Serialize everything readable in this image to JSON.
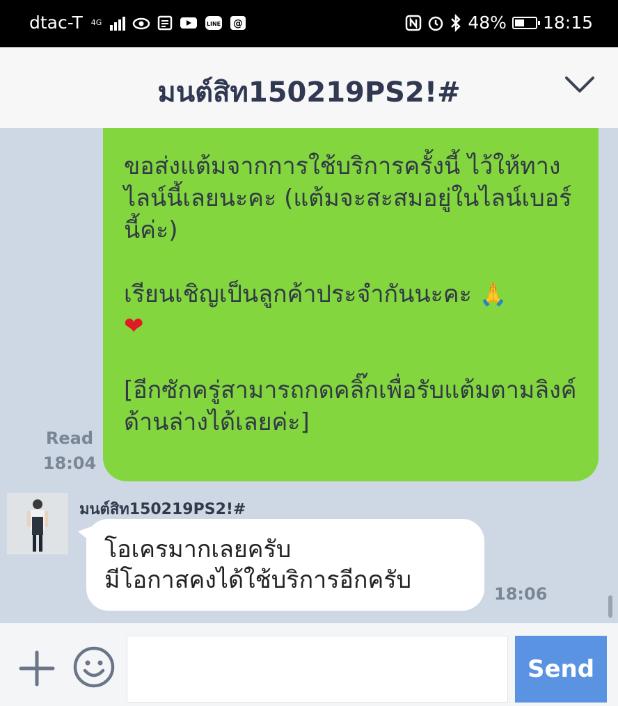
{
  "status_bar": {
    "carrier": "dtac-T",
    "network_badge": "4G",
    "battery_percent": "48%",
    "battery_level": 0.48,
    "time": "18:15",
    "icons": [
      "signal-icon",
      "eye-icon",
      "news-icon",
      "youtube-icon",
      "line-icon",
      "at-icon",
      "nfc-icon",
      "alarm-icon",
      "bluetooth-icon",
      "battery-icon"
    ]
  },
  "header": {
    "title": "มนต์สิท150219PS2!#"
  },
  "messages": {
    "outgoing": {
      "paragraphs": [
        "ขอส่งแต้มจากการใช้บริการครั้งนี้ ไว้ให้ทางไลน์นี้เลยนะคะ (แต้มจะสะสมอยู่ในไลน์เบอร์นี้ค่ะ)",
        "เรียนเชิญเป็นลูกค้าประจำกันนะคะ",
        "[อีกซักครู่สามารถกดคลิ๊กเพื่อรับแต้มตามลิงค์ด้านล่างได้เลยค่ะ]"
      ],
      "emoji_pray": "🙏",
      "emoji_heart": "❤",
      "read_label": "Read",
      "time": "18:04"
    },
    "incoming": {
      "sender": "มนต์สิท150219PS2!#",
      "line1": "โอเครมากเลยครับ",
      "line2": "มีโอกาสคงได้ใช้บริการอีกครับ",
      "time": "18:06"
    }
  },
  "input_bar": {
    "placeholder": "",
    "send_label": "Send"
  },
  "colors": {
    "outgoing_bubble": "#84d63f",
    "chat_background": "#ced8e5",
    "send_button": "#5b93e3"
  }
}
